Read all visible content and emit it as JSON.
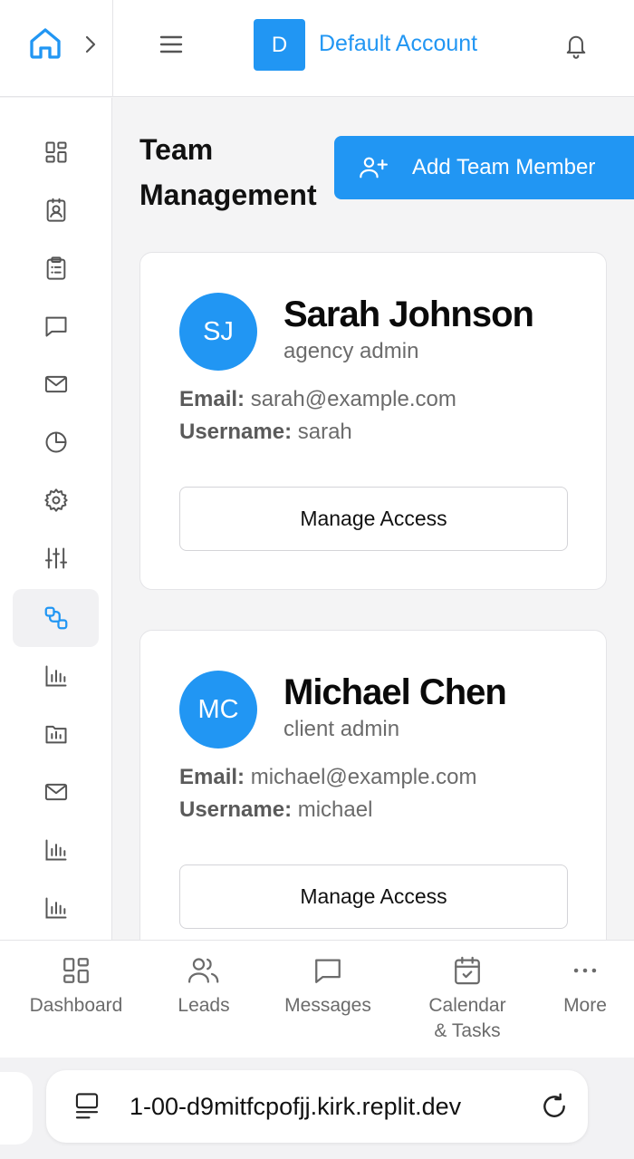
{
  "header": {
    "account_initial": "D",
    "account_name": "Default Account"
  },
  "sidebar": {
    "items": [
      {
        "icon": "dashboard-icon"
      },
      {
        "icon": "contact-card-icon"
      },
      {
        "icon": "clipboard-icon"
      },
      {
        "icon": "message-icon"
      },
      {
        "icon": "mail-icon"
      },
      {
        "icon": "pie-chart-icon"
      },
      {
        "icon": "settings-icon"
      },
      {
        "icon": "sliders-icon"
      },
      {
        "icon": "team-icon",
        "active": true
      },
      {
        "icon": "bar-chart-icon"
      },
      {
        "icon": "folder-chart-icon"
      },
      {
        "icon": "mail-icon"
      },
      {
        "icon": "bar-chart-icon"
      },
      {
        "icon": "bar-chart-icon"
      }
    ]
  },
  "main": {
    "title_line1": "Team",
    "title_line2": "Management",
    "add_button_label": "Add Team Member",
    "members": [
      {
        "initials": "SJ",
        "name": "Sarah Johnson",
        "role": "agency admin",
        "email_label": "Email:",
        "email": "sarah@example.com",
        "username_label": "Username:",
        "username": "sarah",
        "action_label": "Manage Access"
      },
      {
        "initials": "MC",
        "name": "Michael Chen",
        "role": "client admin",
        "email_label": "Email:",
        "email": "michael@example.com",
        "username_label": "Username:",
        "username": "michael",
        "action_label": "Manage Access"
      }
    ]
  },
  "bottom_nav": {
    "items": [
      {
        "label": "Dashboard",
        "icon": "dashboard-icon"
      },
      {
        "label": "Leads",
        "icon": "users-icon"
      },
      {
        "label": "Messages",
        "icon": "message-icon"
      },
      {
        "label": "Calendar & Tasks",
        "icon": "calendar-check-icon"
      },
      {
        "label": "More",
        "icon": "more-icon"
      }
    ]
  },
  "browser": {
    "url": "1-00-d9mitfcpofjj.kirk.replit.dev"
  },
  "colors": {
    "accent": "#2196f3",
    "text_muted": "#6b6b6b",
    "border": "#e4e4e7"
  }
}
